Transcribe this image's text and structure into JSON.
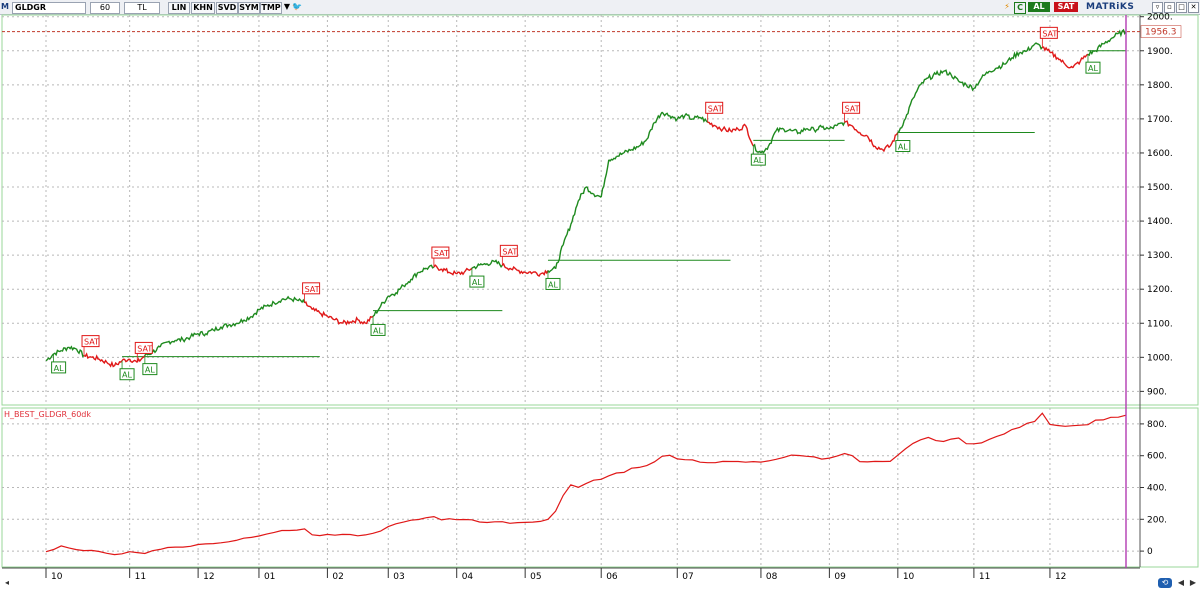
{
  "toolbar": {
    "symbol": "GLDGR",
    "m_icon": "M",
    "period": "60",
    "currency": "TL",
    "buttons": [
      "LIN",
      "KHN",
      "SVD",
      "SYM",
      "TMP"
    ],
    "al_label": "AL",
    "sat_label": "SAT",
    "brand": "MATRiKS",
    "c_icon": "C"
  },
  "colors": {
    "up": "#1e8a1e",
    "down": "#e01818",
    "indicator": "#e01818",
    "cursor": "#b23bb2",
    "panel_border": "#9ad79a",
    "grid": "#b8b8b8",
    "price_ref": "#c0392b",
    "al_button": "#1c7a1c",
    "sat_button": "#c8101a",
    "brand": "#1a3d7c"
  },
  "chart_data": [
    {
      "type": "line",
      "panel": "price",
      "y_ticks": [
        "2000.",
        "1900.",
        "1800.",
        "1700.",
        "1600.",
        "1500.",
        "1400.",
        "1300.",
        "1200.",
        "1100.",
        "1000.",
        "900."
      ],
      "ylim": [
        860,
        2005
      ],
      "last_price_label": "1956.3",
      "last_price": 1956.3,
      "x": [
        0,
        1,
        2,
        3,
        4,
        5,
        6,
        7,
        8,
        9,
        10,
        11,
        12,
        13,
        14,
        15,
        16,
        17,
        18,
        19,
        20,
        21,
        22,
        23,
        24,
        25,
        26,
        27,
        28,
        29,
        30,
        31,
        32,
        33,
        34,
        35,
        36,
        37,
        38,
        39,
        40,
        41,
        42,
        43,
        44,
        45,
        46,
        47,
        48,
        49,
        50,
        51,
        52,
        53,
        54,
        55,
        56,
        57,
        58,
        59,
        60,
        61,
        62,
        63,
        64,
        65,
        66,
        67,
        68,
        69,
        70,
        71,
        72,
        73,
        74,
        75,
        76,
        77,
        78,
        79,
        80,
        81,
        82,
        83,
        84,
        85,
        86,
        87,
        88,
        89,
        90,
        91,
        92,
        93,
        94,
        95,
        96,
        97,
        98,
        99,
        100,
        101,
        102,
        103,
        104,
        105,
        106,
        107,
        108,
        109,
        110,
        111,
        112,
        113,
        114,
        115,
        116,
        117,
        118,
        119,
        120,
        121,
        122,
        123,
        124,
        125,
        126,
        127,
        128,
        129,
        130,
        131,
        132,
        133,
        134,
        135,
        136,
        137,
        138,
        139,
        140,
        141,
        142
      ],
      "values": [
        990,
        1010,
        1020,
        1030,
        1025,
        1005,
        1000,
        995,
        985,
        975,
        990,
        995,
        985,
        1005,
        1015,
        1030,
        1045,
        1050,
        1052,
        1060,
        1070,
        1070,
        1080,
        1090,
        1095,
        1100,
        1110,
        1120,
        1140,
        1150,
        1160,
        1170,
        1172,
        1168,
        1160,
        1140,
        1130,
        1120,
        1110,
        1100,
        1105,
        1110,
        1100,
        1120,
        1150,
        1180,
        1190,
        1210,
        1230,
        1250,
        1262,
        1265,
        1260,
        1250,
        1245,
        1250,
        1262,
        1270,
        1275,
        1280,
        1270,
        1262,
        1255,
        1250,
        1250,
        1245,
        1255,
        1260,
        1330,
        1390,
        1460,
        1500,
        1480,
        1470,
        1580,
        1590,
        1600,
        1610,
        1620,
        1640,
        1690,
        1720,
        1710,
        1700,
        1710,
        1700,
        1705,
        1690,
        1680,
        1670,
        1665,
        1670,
        1680,
        1620,
        1600,
        1620,
        1665,
        1670,
        1665,
        1660,
        1672,
        1668,
        1675,
        1670,
        1680,
        1690,
        1680,
        1660,
        1650,
        1620,
        1610,
        1620,
        1660,
        1700,
        1760,
        1800,
        1820,
        1830,
        1840,
        1830,
        1810,
        1800,
        1790,
        1820,
        1840,
        1850,
        1860,
        1880,
        1895,
        1900,
        1920,
        1910,
        1895,
        1880,
        1860,
        1850,
        1870,
        1890,
        1900,
        1920,
        1935,
        1950,
        1956.3
      ],
      "sell_segments": [
        [
          5,
          13
        ],
        [
          34,
          43
        ],
        [
          51,
          56
        ],
        [
          60,
          66
        ],
        [
          87,
          93
        ],
        [
          105,
          112
        ],
        [
          131,
          137
        ]
      ],
      "signals": [
        {
          "type": "AL",
          "label": "AL",
          "i": 1
        },
        {
          "type": "SAT",
          "label": "SAT",
          "i": 5
        },
        {
          "type": "AL",
          "label": "AL",
          "i": 10
        },
        {
          "type": "SAT",
          "label": "SAT",
          "i": 12
        },
        {
          "type": "AL",
          "label": "AL",
          "i": 13
        },
        {
          "type": "SAT",
          "label": "SAT",
          "i": 34
        },
        {
          "type": "AL",
          "label": "AL",
          "i": 43
        },
        {
          "type": "SAT",
          "label": "SAT",
          "i": 51
        },
        {
          "type": "AL",
          "label": "AL",
          "i": 56
        },
        {
          "type": "SAT",
          "label": "SAT",
          "i": 60
        },
        {
          "type": "AL",
          "label": "AL",
          "i": 66
        },
        {
          "type": "SAT",
          "label": "SAT",
          "i": 87
        },
        {
          "type": "AL",
          "label": "AL",
          "i": 93
        },
        {
          "type": "SAT",
          "label": "SAT",
          "i": 105
        },
        {
          "type": "AL",
          "label": "AL",
          "i": 112
        },
        {
          "type": "SAT",
          "label": "SAT",
          "i": 131
        },
        {
          "type": "AL",
          "label": "AL",
          "i": 137
        }
      ],
      "support_lines": [
        {
          "from": 10,
          "to": 36,
          "value": 1002
        },
        {
          "from": 43,
          "to": 60,
          "value": 1137
        },
        {
          "from": 66,
          "to": 90,
          "value": 1285
        },
        {
          "from": 93,
          "to": 105,
          "value": 1637
        },
        {
          "from": 112,
          "to": 130,
          "value": 1660
        },
        {
          "from": 137,
          "to": 142,
          "value": 1900
        }
      ]
    },
    {
      "type": "line",
      "panel": "indicator",
      "title": "H_BEST_GLDGR_60dk",
      "y_ticks": [
        "800.",
        "600.",
        "400.",
        "200.",
        "0"
      ],
      "ylim": [
        -100,
        900
      ],
      "x": [
        0,
        1,
        2,
        3,
        4,
        5,
        6,
        7,
        8,
        9,
        10,
        11,
        12,
        13,
        14,
        15,
        16,
        17,
        18,
        19,
        20,
        21,
        22,
        23,
        24,
        25,
        26,
        27,
        28,
        29,
        30,
        31,
        32,
        33,
        34,
        35,
        36,
        37,
        38,
        39,
        40,
        41,
        42,
        43,
        44,
        45,
        46,
        47,
        48,
        49,
        50,
        51,
        52,
        53,
        54,
        55,
        56,
        57,
        58,
        59,
        60,
        61,
        62,
        63,
        64,
        65,
        66,
        67,
        68,
        69,
        70,
        71,
        72,
        73,
        74,
        75,
        76,
        77,
        78,
        79,
        80,
        81,
        82,
        83,
        84,
        85,
        86,
        87,
        88,
        89,
        90,
        91,
        92,
        93,
        94,
        95,
        96,
        97,
        98,
        99,
        100,
        101,
        102,
        103,
        104,
        105,
        106,
        107,
        108,
        109,
        110,
        111,
        112,
        113,
        114,
        115,
        116,
        117,
        118,
        119,
        120,
        121,
        122,
        123,
        124,
        125,
        126,
        127,
        128,
        129,
        130,
        131,
        132,
        133,
        134,
        135,
        136,
        137,
        138,
        139,
        140,
        141,
        142
      ],
      "values": [
        0,
        15,
        30,
        25,
        10,
        5,
        0,
        -5,
        -10,
        -20,
        -15,
        -5,
        -10,
        -15,
        5,
        15,
        20,
        25,
        28,
        30,
        40,
        45,
        50,
        55,
        60,
        70,
        80,
        90,
        100,
        110,
        120,
        125,
        130,
        135,
        140,
        100,
        100,
        100,
        100,
        100,
        100,
        100,
        100,
        110,
        130,
        150,
        170,
        180,
        190,
        200,
        210,
        220,
        200,
        200,
        200,
        200,
        200,
        185,
        180,
        180,
        180,
        180,
        180,
        180,
        185,
        190,
        200,
        250,
        350,
        420,
        400,
        420,
        450,
        450,
        470,
        490,
        500,
        520,
        530,
        540,
        560,
        600,
        600,
        580,
        570,
        570,
        560,
        560,
        560,
        560,
        560,
        560,
        560,
        560,
        560,
        570,
        580,
        590,
        600,
        600,
        600,
        590,
        580,
        590,
        600,
        610,
        600,
        560,
        560,
        560,
        560,
        560,
        600,
        640,
        680,
        700,
        710,
        700,
        690,
        700,
        710,
        680,
        680,
        680,
        700,
        720,
        740,
        760,
        780,
        800,
        820,
        870,
        800,
        790,
        790,
        790,
        790,
        800,
        820,
        830,
        840,
        845,
        850
      ]
    }
  ],
  "x_axis": {
    "month_labels": [
      "10",
      "11",
      "12",
      "01",
      "02",
      "03",
      "04",
      "05",
      "06",
      "07",
      "08",
      "09",
      "10",
      "11",
      "12"
    ],
    "month_starts": [
      0,
      11,
      20,
      28,
      37,
      45,
      54,
      63,
      73,
      83,
      94,
      103,
      112,
      122,
      132
    ]
  }
}
